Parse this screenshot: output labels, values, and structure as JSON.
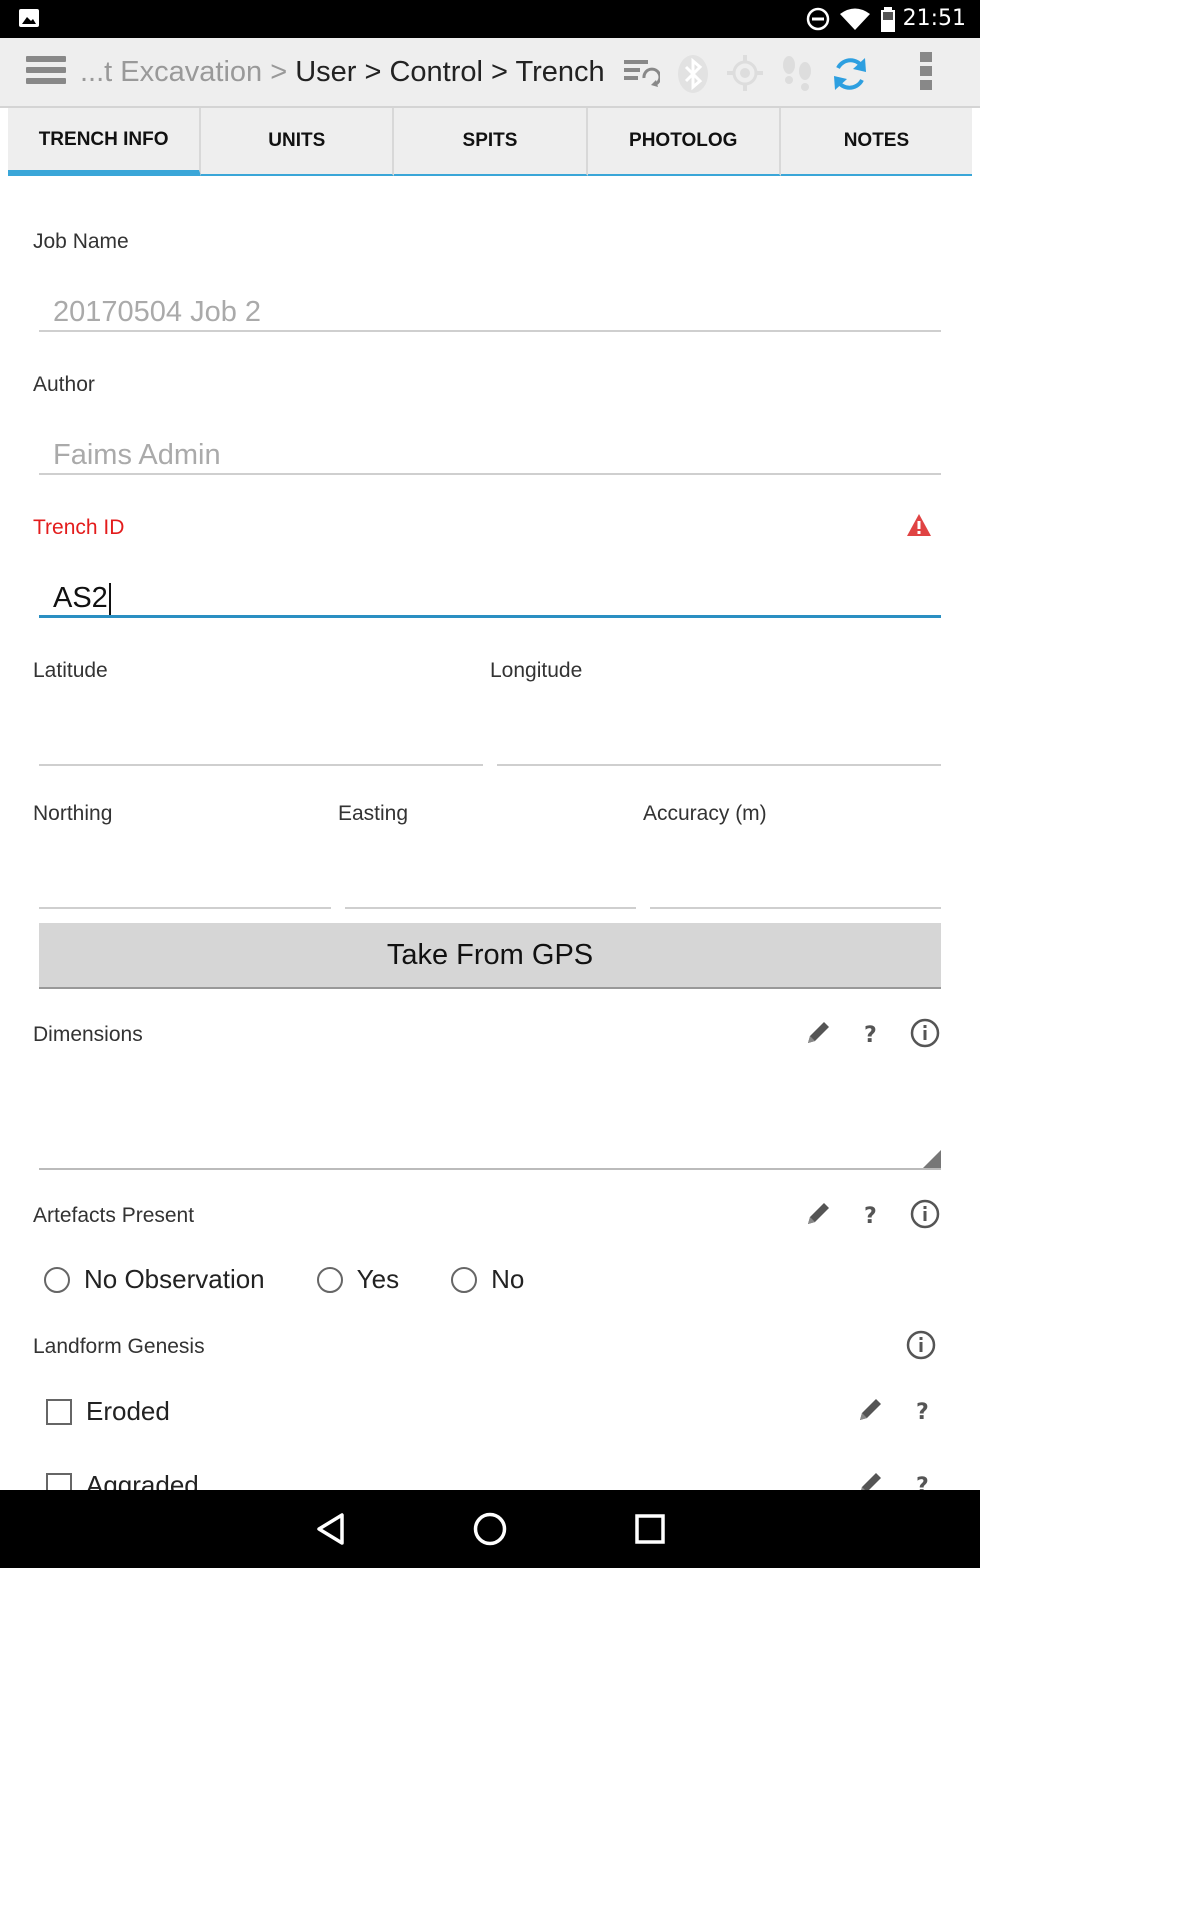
{
  "status_bar": {
    "time": "21:51"
  },
  "header": {
    "breadcrumb_prefix": "...t Excavation >",
    "breadcrumb_current": "User > Control > Trench"
  },
  "tabs": [
    {
      "label": "TRENCH INFO",
      "active": true
    },
    {
      "label": "UNITS"
    },
    {
      "label": "SPITS"
    },
    {
      "label": "PHOTOLOG"
    },
    {
      "label": "NOTES"
    }
  ],
  "form": {
    "job_name": {
      "label": "Job Name",
      "value": "20170504 Job 2"
    },
    "author": {
      "label": "Author",
      "value": "Faims Admin"
    },
    "trench_id": {
      "label": "Trench ID",
      "value": "AS2"
    },
    "latitude": {
      "label": "Latitude",
      "value": ""
    },
    "longitude": {
      "label": "Longitude",
      "value": ""
    },
    "northing": {
      "label": "Northing",
      "value": ""
    },
    "easting": {
      "label": "Easting",
      "value": ""
    },
    "accuracy": {
      "label": "Accuracy (m)",
      "value": ""
    },
    "gps_button": "Take From GPS",
    "dimensions": {
      "label": "Dimensions",
      "value": ""
    },
    "artefacts": {
      "label": "Artefacts Present",
      "options": [
        "No Observation",
        "Yes",
        "No"
      ]
    },
    "landform": {
      "label": "Landform Genesis",
      "options": [
        "Eroded",
        "Aggraded"
      ]
    }
  },
  "colors": {
    "accent": "#3aa6d8",
    "error": "#e31c1c"
  },
  "icons": [
    "menu-icon",
    "sync-list-icon",
    "bluetooth-icon",
    "gps-icon",
    "footprints-icon",
    "refresh-icon",
    "overflow-icon",
    "warning-icon",
    "pencil-icon",
    "help-icon",
    "info-icon",
    "back-icon",
    "home-icon",
    "recents-icon"
  ]
}
